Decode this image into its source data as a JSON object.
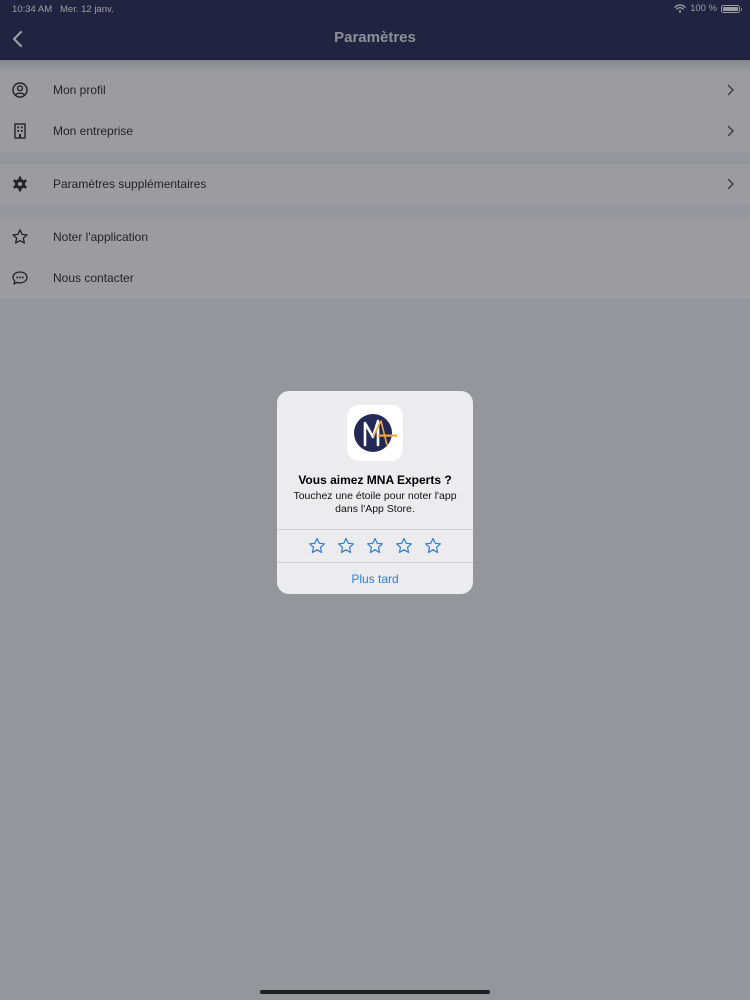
{
  "status_bar": {
    "time": "10:34 AM",
    "date": "Mer. 12 janv.",
    "battery": "100 %"
  },
  "nav": {
    "title": "Paramètres"
  },
  "settings": {
    "groups": [
      [
        {
          "label": "Mon profil",
          "icon": "profile-icon"
        },
        {
          "label": "Mon entreprise",
          "icon": "building-icon"
        }
      ],
      [
        {
          "label": "Paramètres supplémentaires",
          "icon": "gear-icon"
        }
      ],
      [
        {
          "label": "Noter l'application",
          "icon": "star-icon"
        },
        {
          "label": "Nous contacter",
          "icon": "chat-icon"
        }
      ]
    ]
  },
  "alert": {
    "title": "Vous aimez MNA Experts ?",
    "message": "Touchez une étoile pour noter l'app dans l'App Store.",
    "later": "Plus tard",
    "star_count": 5
  },
  "colors": {
    "nav": "#1c2150",
    "accent": "#2c7fd8",
    "icon_orange": "#f2a531"
  }
}
